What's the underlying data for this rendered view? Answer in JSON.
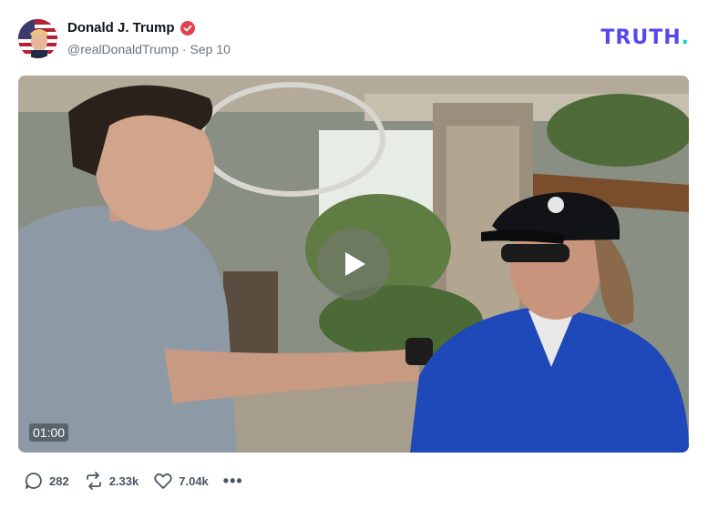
{
  "post": {
    "author_name": "Donald J. Trump",
    "handle": "@realDonaldTrump",
    "separator": "·",
    "date": "Sep 10"
  },
  "brand": {
    "logo_text": "TRUTH",
    "logo_dot": "."
  },
  "video": {
    "duration": "01:00"
  },
  "actions": {
    "replies": "282",
    "retruths": "2.33k",
    "likes": "7.04k",
    "more": "•••"
  },
  "colors": {
    "brand": "#5448ee",
    "brand_accent": "#17d3c2",
    "verified": "#e0424f",
    "muted_text": "#6b7280"
  },
  "icons": [
    "verified-badge-icon",
    "play-icon",
    "reply-icon",
    "retruth-icon",
    "like-icon",
    "more-icon"
  ]
}
